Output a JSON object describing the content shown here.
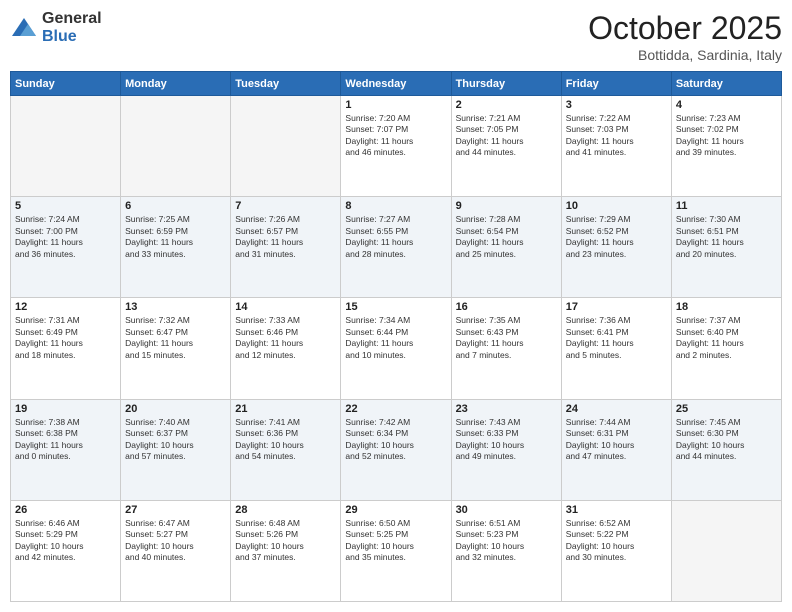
{
  "header": {
    "logo_general": "General",
    "logo_blue": "Blue",
    "title": "October 2025",
    "location": "Bottidda, Sardinia, Italy"
  },
  "weekdays": [
    "Sunday",
    "Monday",
    "Tuesday",
    "Wednesday",
    "Thursday",
    "Friday",
    "Saturday"
  ],
  "weeks": [
    {
      "rowClass": "row-week1",
      "days": [
        {
          "num": "",
          "info": ""
        },
        {
          "num": "",
          "info": ""
        },
        {
          "num": "",
          "info": ""
        },
        {
          "num": "1",
          "info": "Sunrise: 7:20 AM\nSunset: 7:07 PM\nDaylight: 11 hours\nand 46 minutes."
        },
        {
          "num": "2",
          "info": "Sunrise: 7:21 AM\nSunset: 7:05 PM\nDaylight: 11 hours\nand 44 minutes."
        },
        {
          "num": "3",
          "info": "Sunrise: 7:22 AM\nSunset: 7:03 PM\nDaylight: 11 hours\nand 41 minutes."
        },
        {
          "num": "4",
          "info": "Sunrise: 7:23 AM\nSunset: 7:02 PM\nDaylight: 11 hours\nand 39 minutes."
        }
      ]
    },
    {
      "rowClass": "row-week2",
      "days": [
        {
          "num": "5",
          "info": "Sunrise: 7:24 AM\nSunset: 7:00 PM\nDaylight: 11 hours\nand 36 minutes."
        },
        {
          "num": "6",
          "info": "Sunrise: 7:25 AM\nSunset: 6:59 PM\nDaylight: 11 hours\nand 33 minutes."
        },
        {
          "num": "7",
          "info": "Sunrise: 7:26 AM\nSunset: 6:57 PM\nDaylight: 11 hours\nand 31 minutes."
        },
        {
          "num": "8",
          "info": "Sunrise: 7:27 AM\nSunset: 6:55 PM\nDaylight: 11 hours\nand 28 minutes."
        },
        {
          "num": "9",
          "info": "Sunrise: 7:28 AM\nSunset: 6:54 PM\nDaylight: 11 hours\nand 25 minutes."
        },
        {
          "num": "10",
          "info": "Sunrise: 7:29 AM\nSunset: 6:52 PM\nDaylight: 11 hours\nand 23 minutes."
        },
        {
          "num": "11",
          "info": "Sunrise: 7:30 AM\nSunset: 6:51 PM\nDaylight: 11 hours\nand 20 minutes."
        }
      ]
    },
    {
      "rowClass": "row-week3",
      "days": [
        {
          "num": "12",
          "info": "Sunrise: 7:31 AM\nSunset: 6:49 PM\nDaylight: 11 hours\nand 18 minutes."
        },
        {
          "num": "13",
          "info": "Sunrise: 7:32 AM\nSunset: 6:47 PM\nDaylight: 11 hours\nand 15 minutes."
        },
        {
          "num": "14",
          "info": "Sunrise: 7:33 AM\nSunset: 6:46 PM\nDaylight: 11 hours\nand 12 minutes."
        },
        {
          "num": "15",
          "info": "Sunrise: 7:34 AM\nSunset: 6:44 PM\nDaylight: 11 hours\nand 10 minutes."
        },
        {
          "num": "16",
          "info": "Sunrise: 7:35 AM\nSunset: 6:43 PM\nDaylight: 11 hours\nand 7 minutes."
        },
        {
          "num": "17",
          "info": "Sunrise: 7:36 AM\nSunset: 6:41 PM\nDaylight: 11 hours\nand 5 minutes."
        },
        {
          "num": "18",
          "info": "Sunrise: 7:37 AM\nSunset: 6:40 PM\nDaylight: 11 hours\nand 2 minutes."
        }
      ]
    },
    {
      "rowClass": "row-week4",
      "days": [
        {
          "num": "19",
          "info": "Sunrise: 7:38 AM\nSunset: 6:38 PM\nDaylight: 11 hours\nand 0 minutes."
        },
        {
          "num": "20",
          "info": "Sunrise: 7:40 AM\nSunset: 6:37 PM\nDaylight: 10 hours\nand 57 minutes."
        },
        {
          "num": "21",
          "info": "Sunrise: 7:41 AM\nSunset: 6:36 PM\nDaylight: 10 hours\nand 54 minutes."
        },
        {
          "num": "22",
          "info": "Sunrise: 7:42 AM\nSunset: 6:34 PM\nDaylight: 10 hours\nand 52 minutes."
        },
        {
          "num": "23",
          "info": "Sunrise: 7:43 AM\nSunset: 6:33 PM\nDaylight: 10 hours\nand 49 minutes."
        },
        {
          "num": "24",
          "info": "Sunrise: 7:44 AM\nSunset: 6:31 PM\nDaylight: 10 hours\nand 47 minutes."
        },
        {
          "num": "25",
          "info": "Sunrise: 7:45 AM\nSunset: 6:30 PM\nDaylight: 10 hours\nand 44 minutes."
        }
      ]
    },
    {
      "rowClass": "row-week5",
      "days": [
        {
          "num": "26",
          "info": "Sunrise: 6:46 AM\nSunset: 5:29 PM\nDaylight: 10 hours\nand 42 minutes."
        },
        {
          "num": "27",
          "info": "Sunrise: 6:47 AM\nSunset: 5:27 PM\nDaylight: 10 hours\nand 40 minutes."
        },
        {
          "num": "28",
          "info": "Sunrise: 6:48 AM\nSunset: 5:26 PM\nDaylight: 10 hours\nand 37 minutes."
        },
        {
          "num": "29",
          "info": "Sunrise: 6:50 AM\nSunset: 5:25 PM\nDaylight: 10 hours\nand 35 minutes."
        },
        {
          "num": "30",
          "info": "Sunrise: 6:51 AM\nSunset: 5:23 PM\nDaylight: 10 hours\nand 32 minutes."
        },
        {
          "num": "31",
          "info": "Sunrise: 6:52 AM\nSunset: 5:22 PM\nDaylight: 10 hours\nand 30 minutes."
        },
        {
          "num": "",
          "info": ""
        }
      ]
    }
  ]
}
